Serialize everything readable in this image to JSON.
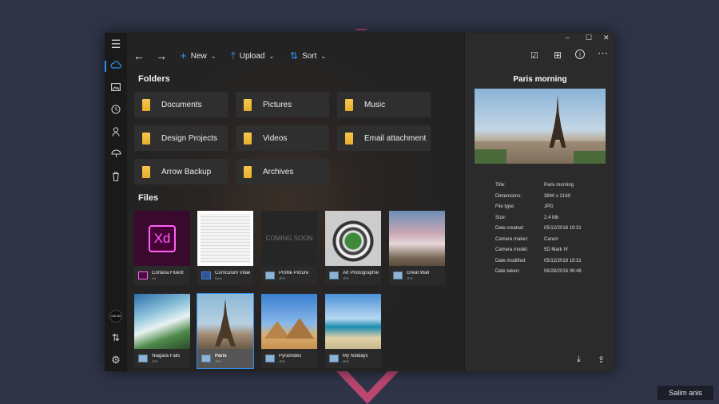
{
  "toolbar": {
    "new_label": "New",
    "upload_label": "Upload",
    "sort_label": "Sort"
  },
  "headings": {
    "folders": "Folders",
    "files": "Files"
  },
  "folders": [
    "Documents",
    "Pictures",
    "Music",
    "Design Projects",
    "Videos",
    "Email attachment",
    "Arrow Backup",
    "Archives"
  ],
  "files": [
    {
      "name": "Cortana Fluent",
      "type": "Xd",
      "thumb_text": "Xd"
    },
    {
      "name": "Curriculum Vitae",
      "type": "Docx"
    },
    {
      "name": "Profile Picture",
      "type": "JPG",
      "thumb_text": "COMING SOON"
    },
    {
      "name": "Art Photographie",
      "type": "JPG"
    },
    {
      "name": "Great Wall",
      "type": "JPG"
    },
    {
      "name": "Niagara Falls",
      "type": "JPG"
    },
    {
      "name": "Paris",
      "type": "JPG"
    },
    {
      "name": "Pyramides",
      "type": "JPG"
    },
    {
      "name": "My holidays",
      "type": "MP4"
    }
  ],
  "rail": {
    "avatar_text": "SALIM"
  },
  "detail": {
    "title": "Paris morning",
    "properties": [
      {
        "key": "Title:",
        "value": "Paris morning"
      },
      {
        "key": "Dimensions:",
        "value": "3840 x 2160"
      },
      {
        "key": "File type:",
        "value": "JPG"
      },
      {
        "key": "Size:",
        "value": "2.4 Mb"
      },
      {
        "key": "Date created:",
        "value": "05/12/2018 19:31"
      },
      {
        "key": "Camera maker:",
        "value": "Canon"
      },
      {
        "key": "Camera model:",
        "value": "5D Mark IV"
      },
      {
        "key": "Date modified:",
        "value": "05/12/2018 19:31"
      },
      {
        "key": "Date taken:",
        "value": "06/28/2016 06:48"
      }
    ]
  },
  "taskbar": {
    "user": "Salim anis"
  },
  "colors": {
    "accent": "#2f8ef0",
    "folder": "#f6c64f",
    "app_bg": "#202020",
    "desktop_bg": "#2f3447"
  }
}
